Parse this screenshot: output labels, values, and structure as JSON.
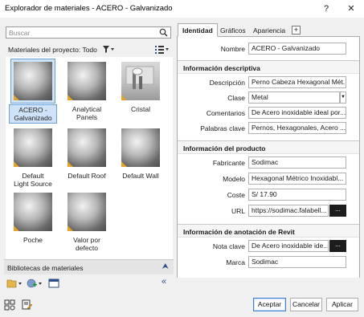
{
  "window": {
    "title": "Explorador de materiales - ACERO - Galvanizado",
    "help": "?",
    "close": "✕"
  },
  "search": {
    "placeholder": "Buscar"
  },
  "project": {
    "label": "Materiales del proyecto: Todo"
  },
  "materials": [
    {
      "label": "ACERO -\nGalvanizado",
      "selected": true
    },
    {
      "label": "Analytical\nPanels"
    },
    {
      "label": "Cristal"
    },
    {
      "label": "Default\nLight Source"
    },
    {
      "label": "Default Roof"
    },
    {
      "label": "Default Wall"
    },
    {
      "label": "Poche"
    },
    {
      "label": "Valor por\ndefecto"
    }
  ],
  "libraries": {
    "label": "Bibliotecas de materiales"
  },
  "tabs": {
    "identidad": "Identidad",
    "graficos": "Gráficos",
    "apariencia": "Apariencia",
    "add": "+"
  },
  "identity": {
    "nombre_label": "Nombre",
    "nombre": "ACERO - Galvanizado",
    "desc_section": "Información descriptiva",
    "descripcion_label": "Descripción",
    "descripcion": "Perno Cabeza Hexagonal Mét...",
    "clase_label": "Clase",
    "clase": "Metal",
    "comentarios_label": "Comentarios",
    "comentarios": "De Acero inoxidable ideal por...",
    "palabras_label": "Palabras clave",
    "palabras": "Pernos, Hexagonales, Acero ...",
    "prod_section": "Información del producto",
    "fabricante_label": "Fabricante",
    "fabricante": "Sodimac",
    "modelo_label": "Modelo",
    "modelo": "Hexagonal Métrico Inoxidabl...",
    "coste_label": "Coste",
    "coste": "S/ 17.90",
    "url_label": "URL",
    "url": "https://sodimac.falabell...",
    "revit_section": "Información de anotación de Revit",
    "nota_label": "Nota clave",
    "nota": "De Acero inoxidable ide...",
    "marca_label": "Marca",
    "marca": "Sodimac",
    "dots": "..."
  },
  "buttons": {
    "aceptar": "Aceptar",
    "cancelar": "Cancelar",
    "aplicar": "Aplicar"
  }
}
